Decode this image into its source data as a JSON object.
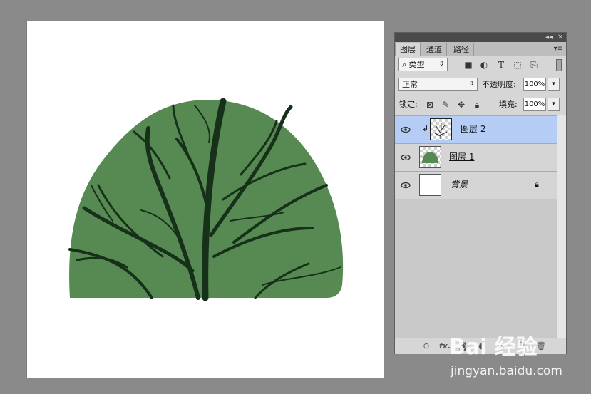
{
  "panel": {
    "tabs": [
      "图层",
      "通道",
      "路径"
    ],
    "top_controls": {
      "collapse": "◂◂",
      "close": "✕",
      "menu": "▾≡"
    },
    "filter": {
      "label": "类型",
      "icon": "search-icon"
    },
    "blend_mode": "正常",
    "opacity_label": "不透明度:",
    "opacity_value": "100%",
    "lock_label": "锁定:",
    "fill_label": "填充:",
    "fill_value": "100%",
    "layers": [
      {
        "name": "图层 2",
        "selected": true,
        "clipped": true
      },
      {
        "name": "图层 1",
        "selected": false,
        "clipped": false
      },
      {
        "name": "背景",
        "selected": false,
        "locked": true
      }
    ],
    "footer_icons": [
      "link-icon",
      "fx-icon",
      "mask-icon",
      "adjustment-icon",
      "folder-icon",
      "new-layer-icon",
      "trash-icon"
    ],
    "fx_label": "fx."
  },
  "colors": {
    "canvas_bg": "#ffffff",
    "bush_fill": "#568a52",
    "branch": "#17301a",
    "selected_layer": "#b5cdf5",
    "app_bg": "#8a8a8a"
  },
  "watermark": {
    "logo": "Bai 经验",
    "url": "jingyan.baidu.com"
  }
}
